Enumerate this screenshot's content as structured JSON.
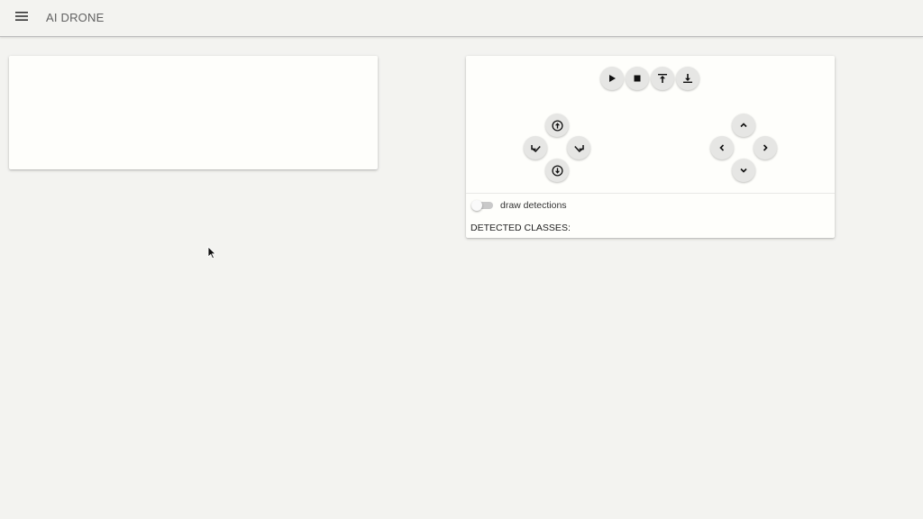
{
  "app": {
    "title": "AI DRONE"
  },
  "icons": {
    "menu": "menu-icon",
    "play": "play-icon",
    "stop": "stop-icon",
    "takeoff": "vertical-align-top-icon",
    "land": "vertical-align-bottom-icon",
    "up": "arrow-circle-up-icon",
    "down": "arrow-circle-down-icon",
    "rotate_left": "rotate-left-icon",
    "rotate_right": "rotate-right-icon",
    "forward": "chevron-up-icon",
    "back": "chevron-down-icon",
    "left": "chevron-left-icon",
    "right": "chevron-right-icon"
  },
  "controls": {
    "draw_detections_label": "draw detections",
    "draw_detections_enabled": false,
    "detected_classes_label": "DETECTED CLASSES:"
  },
  "colors": {
    "background": "#f3f3f0",
    "card": "#fefefb",
    "button": "#e6e6e4"
  }
}
